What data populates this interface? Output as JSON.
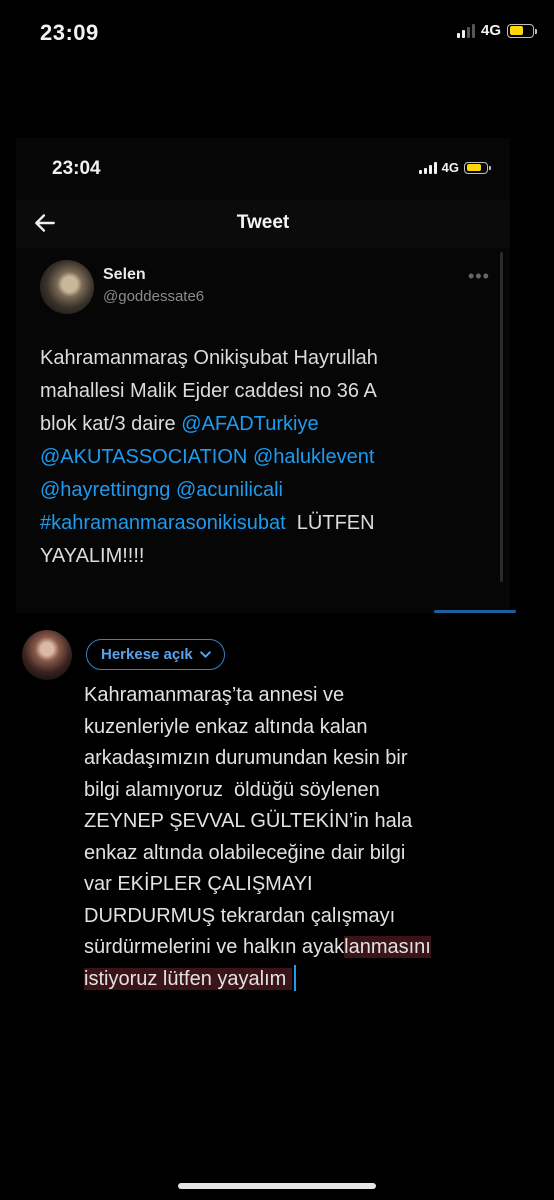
{
  "outer_status": {
    "time": "23:09",
    "network": "4G"
  },
  "inner_status": {
    "time": "23:04",
    "network": "4G"
  },
  "header": {
    "title": "Tweet"
  },
  "tweet": {
    "author_name": "Selen",
    "author_handle": "@goddessate6",
    "more": "•••",
    "lines": {
      "l1": "Kahramanmaraş Onikişubat Hayrullah",
      "l2": "mahallesi Malik Ejder caddesi no 36 A",
      "l3_text": "blok kat/3 daire ",
      "l3_link": "@AFADTurkiye",
      "l4_link1": "@AKUTASSOCIATION",
      "l4_link2": "@haluklevent",
      "l5_link1": "@hayrettingng",
      "l5_link2": "@acunilicali",
      "l6_link": "#kahramanmarasonikisubat",
      "l6_text": "  LÜTFEN",
      "l7": "YAYALIM!!!!"
    }
  },
  "story": {
    "audience_label": "Herkese açık",
    "caption": {
      "c1": "Kahramanmaraş’ta annesi ve",
      "c2": "kuzenleriyle enkaz altında kalan",
      "c3": "arkadaşımızın durumundan kesin bir",
      "c4": "bilgi alamıyoruz  öldüğü söylenen",
      "c5": "ZEYNEP ŞEVVAL GÜLTEKİN’in hala",
      "c6": "enkaz altında olabileceğine dair bilgi",
      "c7": "var EKİPLER ÇALIŞMAYI",
      "c8": "DURDURMUŞ tekrardan çalışmayı",
      "c9a": "sürdürmelerini ve halkın ayak",
      "c9b": "lanmasını",
      "c10": "istiyoruz lütfen yayalım "
    }
  },
  "colors": {
    "link": "#1d9bf0",
    "battery": "#ffd60a",
    "background": "#000000"
  }
}
